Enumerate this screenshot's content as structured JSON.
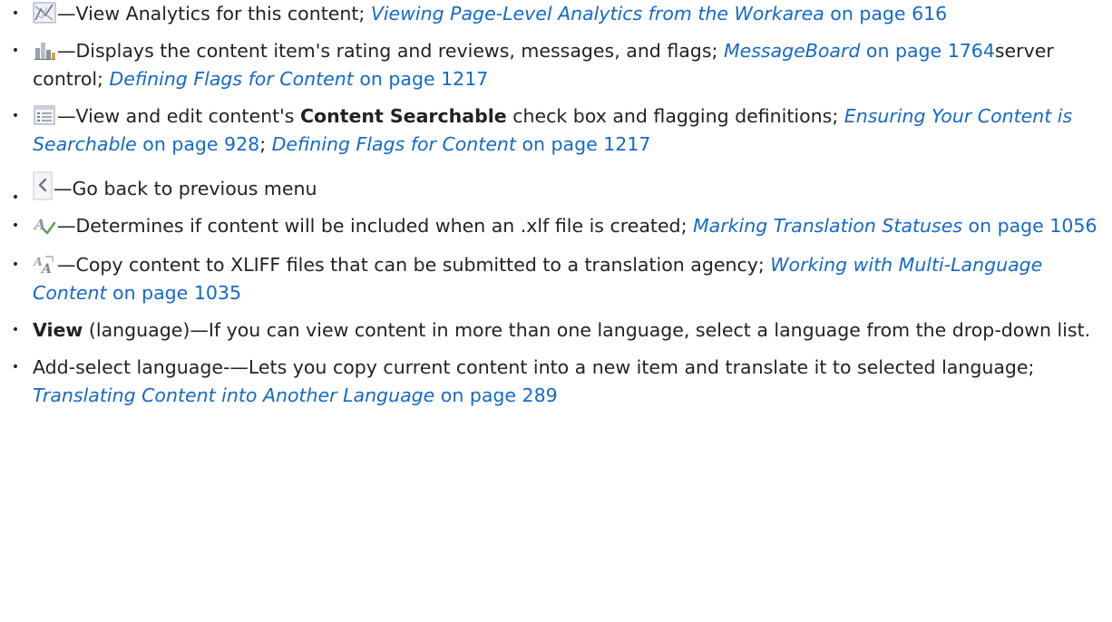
{
  "items": [
    {
      "icon": "analytics-icon",
      "text": "—View Analytics for this content; ",
      "link_italic": "Viewing Page-Level Analytics from the Workarea",
      "link_page": " on page 616"
    },
    {
      "icon": "bar-chart-icon",
      "text": "—Displays the content item's rating and reviews, messages, and flags; ",
      "link1_italic": "MessageBoard",
      "link1_page": " on page 1764",
      "mid": "server control; ",
      "link2_italic": "Defining Flags for Content",
      "link2_page": " on page 1217"
    },
    {
      "icon": "properties-list-icon",
      "text_before": "—View and edit content's ",
      "bold": "Content Searchable",
      "text_after": " check box and flagging definitions; ",
      "link1_italic": "Ensuring Your Content is Searchable",
      "link1_page": " on page 928",
      "sep": "; ",
      "link2_italic": "Defining Flags for Content",
      "link2_page": " on page 1217"
    },
    {
      "icon": "back-arrow-icon",
      "text": "—Go back to previous menu"
    },
    {
      "icon": "translation-status-icon",
      "text": "—Determines if content will be included when an .xlf file is created; ",
      "link_italic": "Marking Translation Statuses",
      "link_page": " on page 1056"
    },
    {
      "icon": "xliff-export-icon",
      "text": "—Copy content to XLIFF files that can be submitted to a translation agency; ",
      "link_italic": "Working with Multi-Language Content",
      "link_page": " on page 1035"
    },
    {
      "bold": "View",
      "text": " (language)—If you can view content in more than one language, select a language from the drop-down list."
    },
    {
      "text": "Add-select language-—Lets you copy current content into a new item and translate it to selected language; ",
      "link_italic": "Translating Content into Another Language",
      "link_page": " on page 289"
    }
  ],
  "colors": {
    "link": "#1569c7",
    "text": "#222222"
  }
}
